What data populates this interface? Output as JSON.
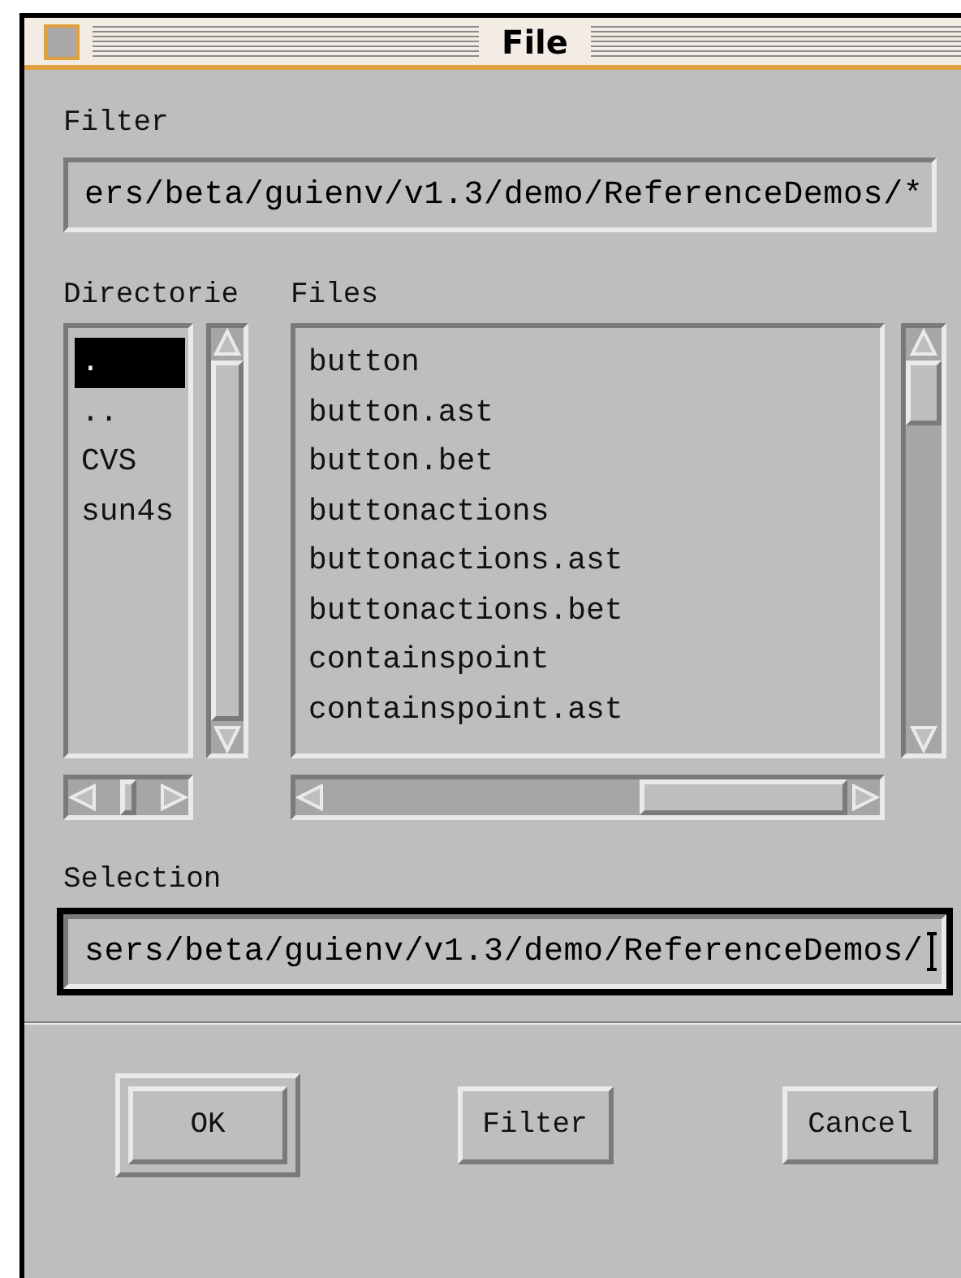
{
  "window": {
    "title": "File"
  },
  "filter": {
    "label": "Filter",
    "value": "ers/beta/guienv/v1.3/demo/ReferenceDemos/*"
  },
  "directories": {
    "label": "Directorie",
    "items": [
      {
        "name": ".",
        "selected": true
      },
      {
        "name": "..",
        "selected": false
      },
      {
        "name": "CVS",
        "selected": false
      },
      {
        "name": "sun4s",
        "selected": false
      }
    ]
  },
  "files": {
    "label": "Files",
    "items": [
      {
        "name": "button",
        "selected": false
      },
      {
        "name": "button.ast",
        "selected": false
      },
      {
        "name": "button.bet",
        "selected": false
      },
      {
        "name": "buttonactions",
        "selected": false
      },
      {
        "name": "buttonactions.ast",
        "selected": false
      },
      {
        "name": "buttonactions.bet",
        "selected": false
      },
      {
        "name": "containspoint",
        "selected": false
      },
      {
        "name": "containspoint.ast",
        "selected": false
      }
    ]
  },
  "selection": {
    "label": "Selection",
    "value": "sers/beta/guienv/v1.3/demo/ReferenceDemos/"
  },
  "buttons": [
    {
      "label": "OK",
      "default": true
    },
    {
      "label": "Filter",
      "default": false
    },
    {
      "label": "Cancel",
      "default": false
    }
  ]
}
